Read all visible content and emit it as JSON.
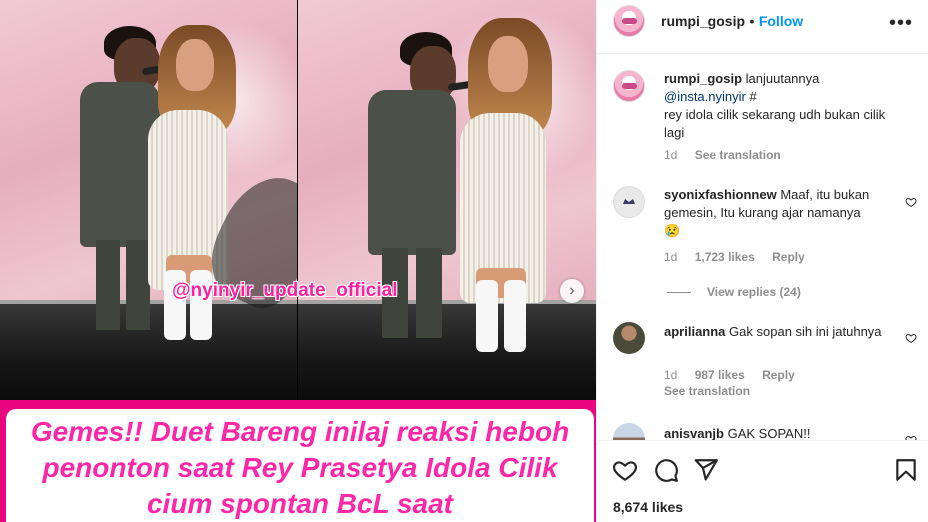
{
  "post": {
    "watermark": "@nyinyir_update_official",
    "headline": "Gemes!! Duet Bareng inilaj reaksi heboh penonton saat Rey Prasetya Idola Cilik cium spontan BcL saat",
    "next_icon": "chevron-right-icon"
  },
  "header": {
    "username": "rumpi_gosip",
    "separator": "•",
    "follow_label": "Follow",
    "more_icon": "more-horizontal-icon"
  },
  "caption": {
    "username": "rumpi_gosip",
    "text_1": "lanjuutannya",
    "mention": "@insta.nyinyir",
    "text_2": "#",
    "text_3": "rey idola cilik sekarang udh bukan cilik lagi",
    "time": "1d",
    "see_translation": "See translation"
  },
  "comments": [
    {
      "username": "syonixfashionnew",
      "text": "Maaf, itu bukan gemesin, Itu kurang ajar namanya",
      "emoji": "😢",
      "time": "1d",
      "likes": "1,723 likes",
      "reply": "Reply",
      "view_replies": "View replies (24)"
    },
    {
      "username": "aprilianna",
      "text": "Gak sopan sih ini jatuhnya",
      "time": "1d",
      "likes": "987 likes",
      "reply": "Reply",
      "see_translation": "See translation"
    },
    {
      "username": "anisvanjb",
      "text": "GAK SOPAN!!"
    }
  ],
  "footer": {
    "likes": "8,674 likes"
  },
  "colors": {
    "accent": "#0095f6",
    "banner_magenta": "#e9067f",
    "headline_pink": "#ff27a8",
    "watermark_pink": "#ff1fa0"
  }
}
